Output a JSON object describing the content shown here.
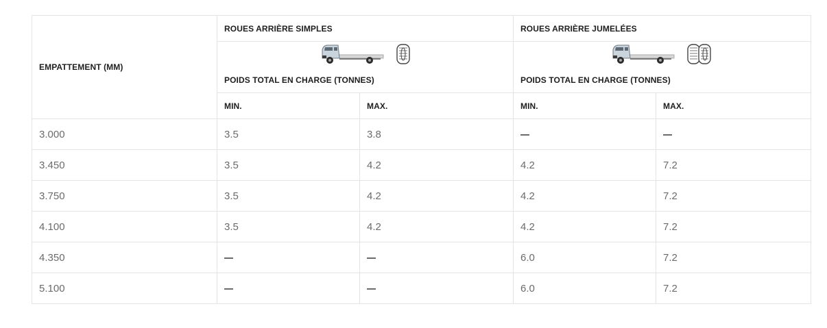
{
  "table": {
    "header": {
      "wheelbase": "EMPATTEMENT (MM)",
      "group_single": "ROUES ARRIÈRE SIMPLES",
      "group_dual": "ROUES ARRIÈRE JUMELÉES",
      "gvw_single": "POIDS TOTAL EN CHARGE (TONNES)",
      "gvw_dual": "POIDS TOTAL EN CHARGE (TONNES)",
      "min_single": "MIN.",
      "max_single": "MAX.",
      "min_dual": "MIN.",
      "max_dual": "MAX."
    },
    "icons": {
      "single": [
        "chassis-cab-truck-icon",
        "single-rear-wheel-icon"
      ],
      "dual": [
        "chassis-cab-truck-icon",
        "dual-rear-wheel-icon"
      ]
    },
    "rows": [
      {
        "wheelbase": "3.000",
        "single_min": "3.5",
        "single_max": "3.8",
        "dual_min": "—",
        "dual_max": "—"
      },
      {
        "wheelbase": "3.450",
        "single_min": "3.5",
        "single_max": "4.2",
        "dual_min": "4.2",
        "dual_max": "7.2"
      },
      {
        "wheelbase": "3.750",
        "single_min": "3.5",
        "single_max": "4.2",
        "dual_min": "4.2",
        "dual_max": "7.2"
      },
      {
        "wheelbase": "4.100",
        "single_min": "3.5",
        "single_max": "4.2",
        "dual_min": "4.2",
        "dual_max": "7.2"
      },
      {
        "wheelbase": "4.350",
        "single_min": "—",
        "single_max": "—",
        "dual_min": "6.0",
        "dual_max": "7.2"
      },
      {
        "wheelbase": "5.100",
        "single_min": "—",
        "single_max": "—",
        "dual_min": "6.0",
        "dual_max": "7.2"
      }
    ]
  }
}
